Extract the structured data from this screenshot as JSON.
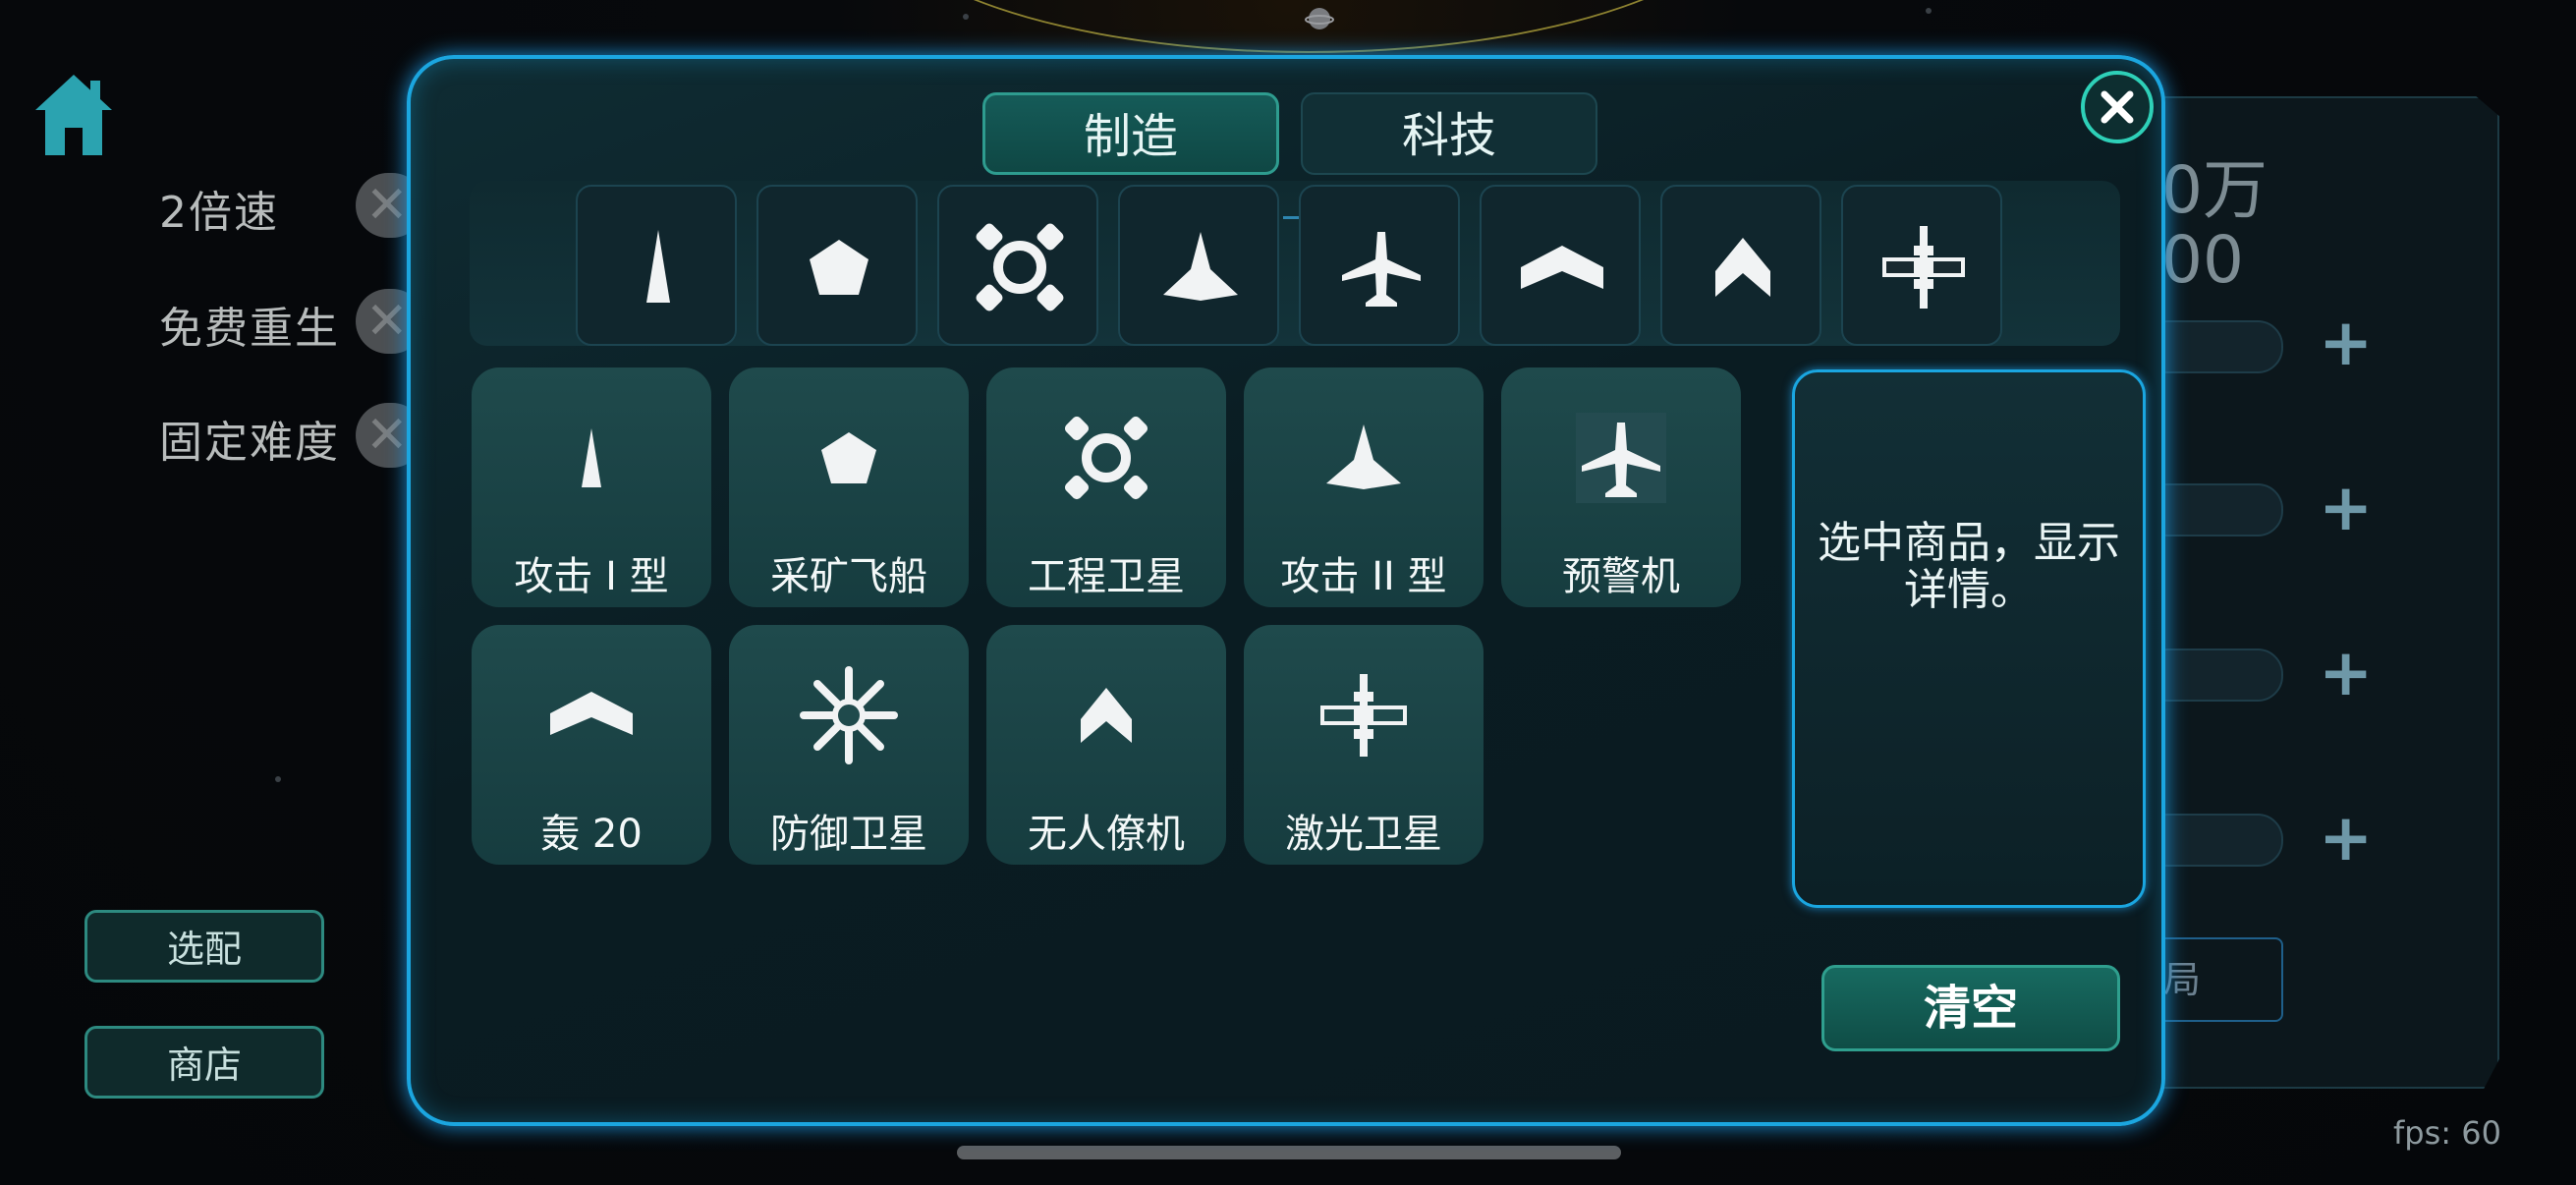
{
  "options": [
    {
      "label": "2倍速"
    },
    {
      "label": "免费重生"
    },
    {
      "label": "固定难度"
    }
  ],
  "side_buttons": {
    "loadout": "选配",
    "shop": "商店"
  },
  "tabs": {
    "make": "制造",
    "tech": "科技"
  },
  "category_icons": [
    "attack-i-icon",
    "mining-ship-icon",
    "engineering-satellite-icon",
    "attack-ii-icon",
    "awacs-icon",
    "bomber-icon",
    "drone-icon",
    "laser-satellite-icon"
  ],
  "items": [
    {
      "label": "攻击 I 型",
      "icon": "attack-i-icon"
    },
    {
      "label": "采矿飞船",
      "icon": "mining-ship-icon"
    },
    {
      "label": "工程卫星",
      "icon": "engineering-satellite-icon"
    },
    {
      "label": "攻击 II 型",
      "icon": "attack-ii-icon"
    },
    {
      "label": "预警机",
      "icon": "awacs-icon"
    },
    {
      "label": "轰 20",
      "icon": "bomber-icon"
    },
    {
      "label": "防御卫星",
      "icon": "defense-satellite-icon"
    },
    {
      "label": "无人僚机",
      "icon": "drone-icon"
    },
    {
      "label": "激光卫星",
      "icon": "laser-satellite-icon"
    }
  ],
  "detail": {
    "text": "选中商品，显示详情。"
  },
  "clear_button": "清空",
  "background_panel": {
    "line1": "0万",
    "line2": "00",
    "button_fragment": "局"
  },
  "fps": "fps: 60",
  "colors": {
    "accent_border": "#1ba6e0",
    "teal_button": "#176a60",
    "home_icon": "#2ba3b0"
  }
}
